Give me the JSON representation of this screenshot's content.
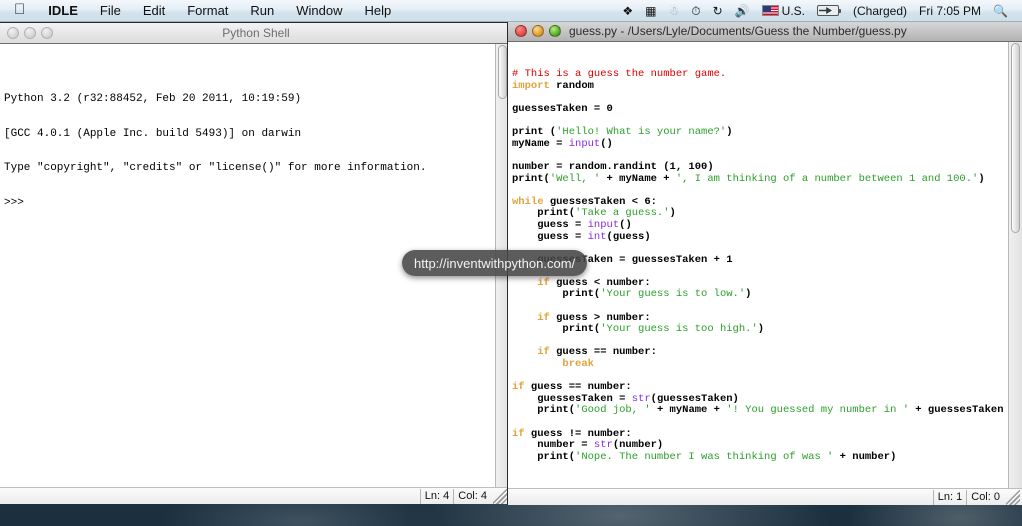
{
  "menubar": {
    "apple_icon": "apple-logo-icon",
    "items": [
      {
        "label": "IDLE",
        "bold": true
      },
      {
        "label": "File",
        "bold": false
      },
      {
        "label": "Edit",
        "bold": false
      },
      {
        "label": "Format",
        "bold": false
      },
      {
        "label": "Run",
        "bold": false
      },
      {
        "label": "Window",
        "bold": false
      },
      {
        "label": "Help",
        "bold": false
      }
    ],
    "status": {
      "dropbox_icon": "dropbox-icon",
      "screensharing_icon": "display-icon",
      "bluetooth_icon": "bluetooth-icon",
      "timemachine_icon": "time-machine-icon",
      "sync_icon": "sync-refresh-icon",
      "volume_icon": "volume-icon",
      "flag_icon": "us-flag-icon",
      "input_label": "U.S.",
      "battery_icon": "battery-icon",
      "battery_label": "(Charged)",
      "clock": "Fri 7:05 PM",
      "search_icon": "spotlight-search-icon"
    }
  },
  "shell_window": {
    "title": "Python Shell",
    "lights": [
      "close",
      "minimize",
      "maximize"
    ],
    "lines": [
      "Python 3.2 (r32:88452, Feb 20 2011, 10:19:59)",
      "[GCC 4.0.1 (Apple Inc. build 5493)] on darwin",
      "Type \"copyright\", \"credits\" or \"license()\" for more information.",
      ">>>"
    ],
    "status": {
      "line_label": "Ln: 4",
      "col_label": "Col: 4"
    }
  },
  "editor_window": {
    "title": "guess.py - /Users/Lyle/Documents/Guess the Number/guess.py",
    "lights": [
      "close",
      "minimize",
      "maximize"
    ],
    "status": {
      "line_label": "Ln: 1",
      "col_label": "Col: 0"
    },
    "code_lines": [
      [
        {
          "t": "# This is a guess the number game.",
          "c": "tk-comment"
        }
      ],
      [
        {
          "t": "import",
          "c": "tk-kw"
        },
        {
          "t": " random",
          "c": "tk-plain"
        }
      ],
      [],
      [
        {
          "t": "guessesTaken = 0",
          "c": "tk-plain"
        }
      ],
      [],
      [
        {
          "t": "print (",
          "c": "tk-plain"
        },
        {
          "t": "'Hello! What is your name?'",
          "c": "tk-str"
        },
        {
          "t": ")",
          "c": "tk-plain"
        }
      ],
      [
        {
          "t": "myName = ",
          "c": "tk-plain"
        },
        {
          "t": "input",
          "c": "tk-builtin"
        },
        {
          "t": "()",
          "c": "tk-plain"
        }
      ],
      [],
      [
        {
          "t": "number = random.randint (1, 100)",
          "c": "tk-plain"
        }
      ],
      [
        {
          "t": "print(",
          "c": "tk-plain"
        },
        {
          "t": "'Well, '",
          "c": "tk-str"
        },
        {
          "t": " + myName + ",
          "c": "tk-plain"
        },
        {
          "t": "', I am thinking of a number between 1 and 100.'",
          "c": "tk-str"
        },
        {
          "t": ")",
          "c": "tk-plain"
        }
      ],
      [],
      [
        {
          "t": "while",
          "c": "tk-kw"
        },
        {
          "t": " guessesTaken < 6:",
          "c": "tk-plain"
        }
      ],
      [
        {
          "t": "    print(",
          "c": "tk-plain"
        },
        {
          "t": "'Take a guess.'",
          "c": "tk-str"
        },
        {
          "t": ")",
          "c": "tk-plain"
        }
      ],
      [
        {
          "t": "    guess = ",
          "c": "tk-plain"
        },
        {
          "t": "input",
          "c": "tk-builtin"
        },
        {
          "t": "()",
          "c": "tk-plain"
        }
      ],
      [
        {
          "t": "    guess = ",
          "c": "tk-plain"
        },
        {
          "t": "int",
          "c": "tk-builtin"
        },
        {
          "t": "(guess)",
          "c": "tk-plain"
        }
      ],
      [],
      [
        {
          "t": "    guessesTaken = guessesTaken + 1",
          "c": "tk-plain"
        }
      ],
      [],
      [
        {
          "t": "    ",
          "c": "tk-plain"
        },
        {
          "t": "if",
          "c": "tk-kw"
        },
        {
          "t": " guess < number:",
          "c": "tk-plain"
        }
      ],
      [
        {
          "t": "        print(",
          "c": "tk-plain"
        },
        {
          "t": "'Your guess is to low.'",
          "c": "tk-str"
        },
        {
          "t": ")",
          "c": "tk-plain"
        }
      ],
      [],
      [
        {
          "t": "    ",
          "c": "tk-plain"
        },
        {
          "t": "if",
          "c": "tk-kw"
        },
        {
          "t": " guess > number:",
          "c": "tk-plain"
        }
      ],
      [
        {
          "t": "        print(",
          "c": "tk-plain"
        },
        {
          "t": "'Your guess is too high.'",
          "c": "tk-str"
        },
        {
          "t": ")",
          "c": "tk-plain"
        }
      ],
      [],
      [
        {
          "t": "    ",
          "c": "tk-plain"
        },
        {
          "t": "if",
          "c": "tk-kw"
        },
        {
          "t": " guess == number:",
          "c": "tk-plain"
        }
      ],
      [
        {
          "t": "        ",
          "c": "tk-plain"
        },
        {
          "t": "break",
          "c": "tk-kw"
        }
      ],
      [],
      [
        {
          "t": "if",
          "c": "tk-kw"
        },
        {
          "t": " guess == number:",
          "c": "tk-plain"
        }
      ],
      [
        {
          "t": "    guessesTaken = ",
          "c": "tk-plain"
        },
        {
          "t": "str",
          "c": "tk-builtin"
        },
        {
          "t": "(guessesTaken)",
          "c": "tk-plain"
        }
      ],
      [
        {
          "t": "    print(",
          "c": "tk-plain"
        },
        {
          "t": "'Good job, '",
          "c": "tk-str"
        },
        {
          "t": " + myName + ",
          "c": "tk-plain"
        },
        {
          "t": "'! You guessed my number in '",
          "c": "tk-str"
        },
        {
          "t": " + guessesTaken + ",
          "c": "tk-plain"
        }
      ],
      [],
      [
        {
          "t": "if",
          "c": "tk-kw"
        },
        {
          "t": " guess != number:",
          "c": "tk-plain"
        }
      ],
      [
        {
          "t": "    number = ",
          "c": "tk-plain"
        },
        {
          "t": "str",
          "c": "tk-builtin"
        },
        {
          "t": "(number)",
          "c": "tk-plain"
        }
      ],
      [
        {
          "t": "    print(",
          "c": "tk-plain"
        },
        {
          "t": "'Nope. The number I was thinking of was '",
          "c": "tk-str"
        },
        {
          "t": " + number)",
          "c": "tk-plain"
        }
      ]
    ]
  },
  "tooltip": {
    "text": "http://inventwithpython.com/"
  },
  "colors": {
    "comment": "#dd0000",
    "keyword": "#e2a33c",
    "builtin": "#8a2be2",
    "string": "#2ba02b",
    "menubar_bg": "#dfeaf2",
    "desktop": "#24394a"
  }
}
